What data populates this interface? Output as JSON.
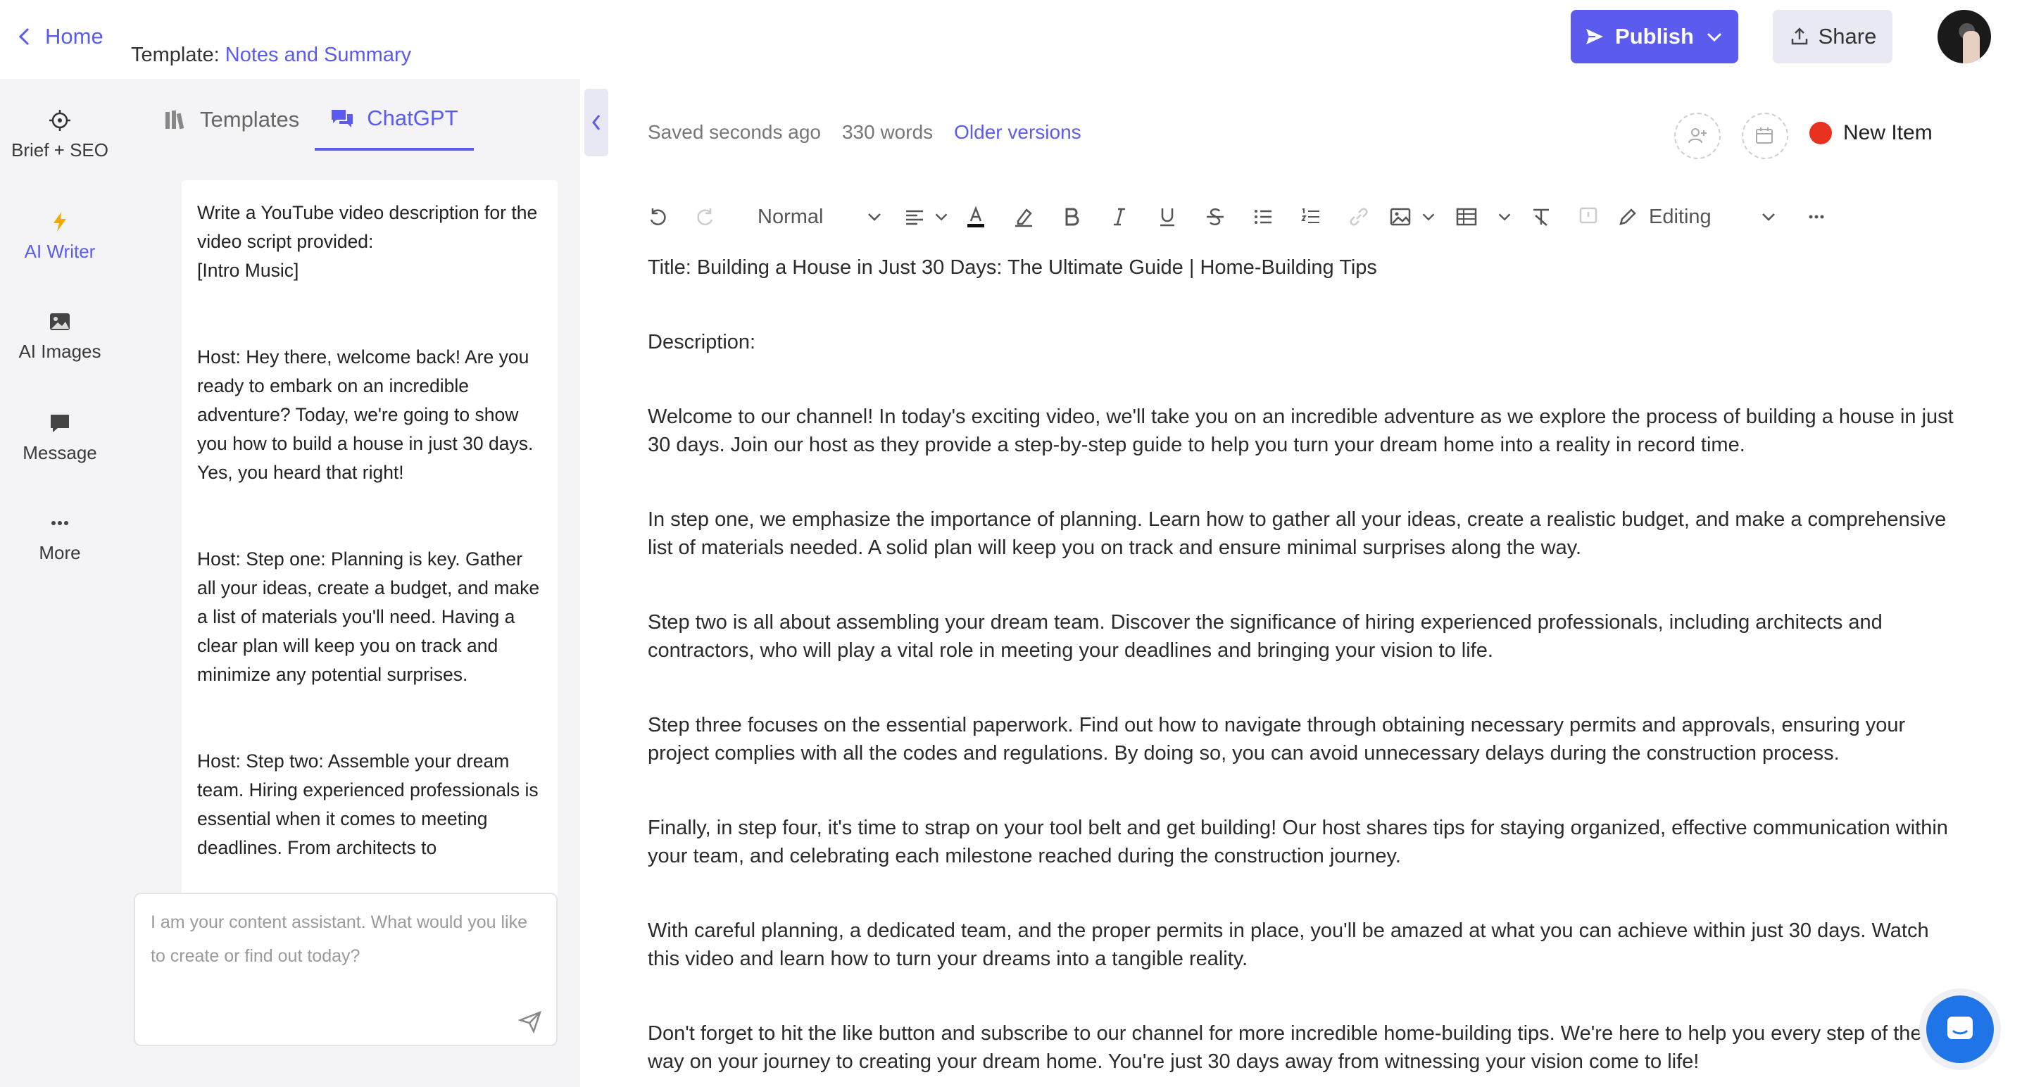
{
  "header": {
    "home_label": "Home",
    "template_prefix": "Template:",
    "template_name": "Notes and Summary",
    "publish_label": "Publish",
    "share_label": "Share"
  },
  "leftnav": {
    "items": [
      {
        "label": "Brief + SEO",
        "icon": "target-icon"
      },
      {
        "label": "AI Writer",
        "icon": "lightning-icon",
        "active": true
      },
      {
        "label": "AI Images",
        "icon": "image-icon"
      },
      {
        "label": "Message",
        "icon": "message-icon"
      },
      {
        "label": "More",
        "icon": "more-dots-icon"
      }
    ]
  },
  "sidepanel": {
    "tabs": [
      {
        "label": "Templates",
        "icon": "books-icon"
      },
      {
        "label": "ChatGPT",
        "icon": "chat-icon",
        "active": true
      }
    ],
    "messages": [
      "Write a YouTube video description for the video script provided:\n[Intro Music]",
      "Host: Hey there, welcome back! Are you ready to embark on an incredible adventure? Today, we're going to show you how to build a house in just 30 days. Yes, you heard that right!",
      "Host: Step one: Planning is key. Gather all your ideas, create a budget, and make a list of materials you'll need. Having a clear plan will keep you on track and minimize any potential surprises.",
      "Host: Step two: Assemble your dream team. Hiring experienced professionals is essential when it comes to meeting deadlines. From architects to"
    ],
    "input_placeholder": "I am your content assistant. What would you like to create or find out today?"
  },
  "editor": {
    "saved_status": "Saved seconds ago",
    "word_count": "330 words",
    "older_versions": "Older versions",
    "item_status": "New Item",
    "status_color": "#e8321f",
    "toolbar": {
      "paragraph_style": "Normal",
      "mode": "Editing"
    },
    "paragraphs": [
      "Title: Building a House in Just 30 Days: The Ultimate Guide | Home-Building Tips",
      "Description:",
      "Welcome to our channel! In today's exciting video, we'll take you on an incredible adventure as we explore the process of building a house in just 30 days. Join our host as they provide a step-by-step guide to help you turn your dream home into a reality in record time.",
      "In step one, we emphasize the importance of planning. Learn how to gather all your ideas, create a realistic budget, and make a comprehensive list of materials needed. A solid plan will keep you on track and ensure minimal surprises along the way.",
      "Step two is all about assembling your dream team. Discover the significance of hiring experienced professionals, including architects and contractors, who will play a vital role in meeting your deadlines and bringing your vision to life.",
      "Step three focuses on the essential paperwork. Find out how to navigate through obtaining necessary permits and approvals, ensuring your project complies with all the codes and regulations. By doing so, you can avoid unnecessary delays during the construction process.",
      "Finally, in step four, it's time to strap on your tool belt and get building! Our host shares tips for staying organized, effective communication within your team, and celebrating each milestone reached during the construction journey.",
      "With careful planning, a dedicated team, and the proper permits in place, you'll be amazed at what you can achieve within just 30 days. Watch this video and learn how to turn your dreams into a tangible reality.",
      "Don't forget to hit the like button and subscribe to our channel for more incredible home-building tips. We're here to help you every step of the way on your journey to creating your dream home. You're just 30 days away from witnessing your vision come to life!"
    ]
  },
  "colors": {
    "accent": "#5b5bf0",
    "chat_bubble": "#1f74e8"
  }
}
